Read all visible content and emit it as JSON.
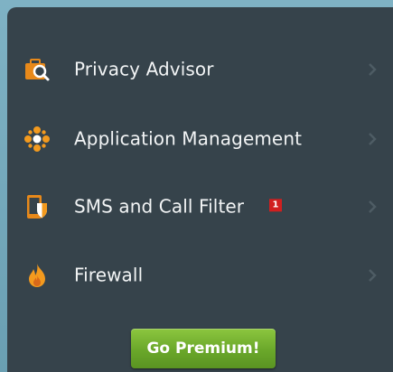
{
  "menu": {
    "partial_item": {
      "label": "",
      "icon": "partially-hidden-icon"
    },
    "items": [
      {
        "label": "Privacy Advisor",
        "icon": "privacy-advisor-icon"
      },
      {
        "label": "Application Management",
        "icon": "application-management-icon"
      },
      {
        "label": "SMS and Call Filter",
        "icon": "sms-call-filter-icon",
        "badge": "1"
      },
      {
        "label": "Firewall",
        "icon": "firewall-icon"
      }
    ]
  },
  "premium_button": {
    "label": "Go Premium!"
  },
  "colors": {
    "panel_background": "#36434b",
    "icon_orange": "#f39a1e",
    "badge_red": "#d11f1f",
    "premium_green": "#6aa72a",
    "frame_teal": "#7fb2c4"
  }
}
